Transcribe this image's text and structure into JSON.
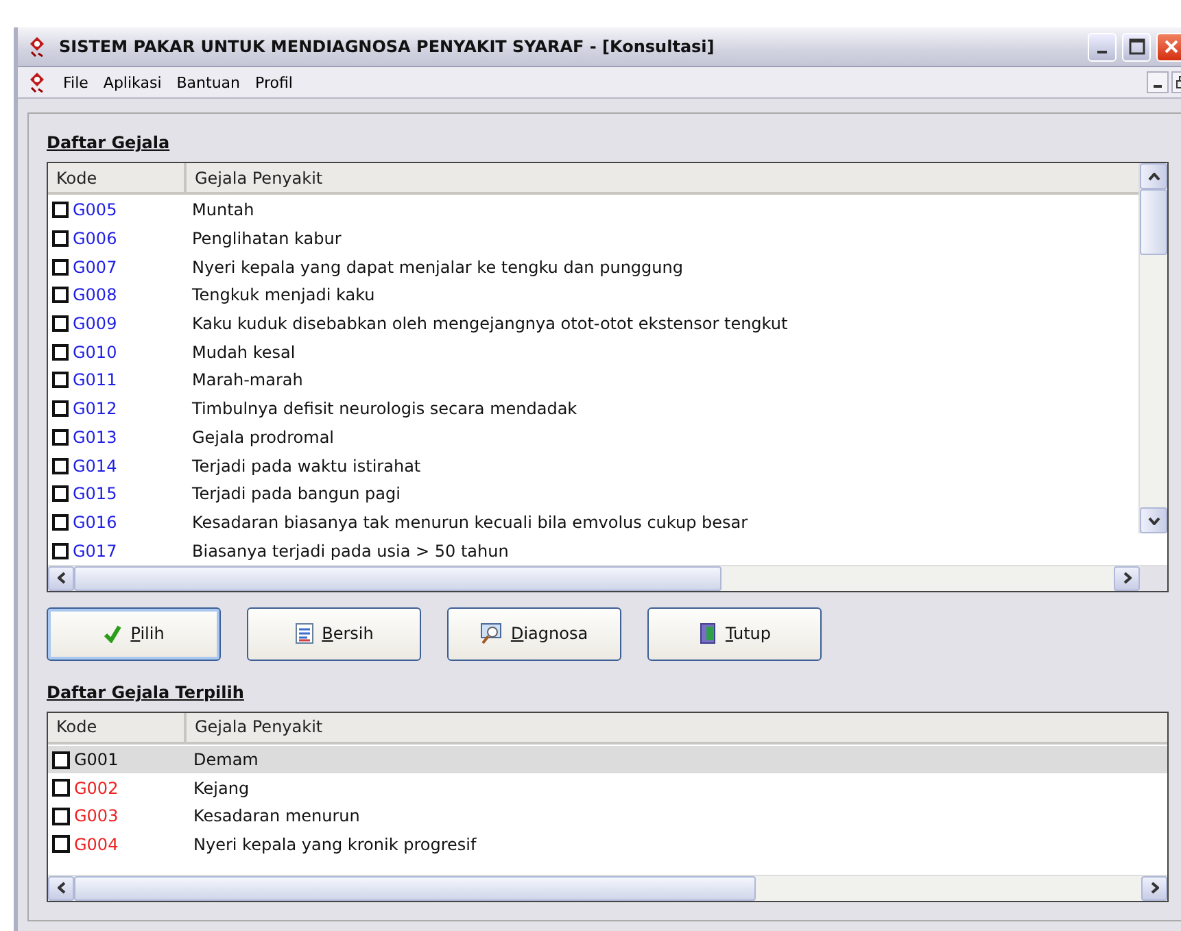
{
  "window": {
    "title": "SISTEM PAKAR UNTUK MENDIAGNOSA PENYAKIT SYARAF - [Konsultasi]"
  },
  "menu": [
    "File",
    "Aplikasi",
    "Bantuan",
    "Profil"
  ],
  "symptoms": {
    "heading": "Daftar Gejala",
    "columns": [
      "Kode",
      "Gejala Penyakit"
    ],
    "rows": [
      {
        "code": "G005",
        "name": "Muntah",
        "checked": false,
        "color": "#1e1ee6"
      },
      {
        "code": "G006",
        "name": "Penglihatan kabur",
        "checked": false,
        "color": "#1e1ee6"
      },
      {
        "code": "G007",
        "name": "Nyeri kepala yang dapat menjalar ke tengku dan punggung",
        "checked": false,
        "color": "#1e1ee6"
      },
      {
        "code": "G008",
        "name": "Tengkuk menjadi kaku",
        "checked": false,
        "color": "#1e1ee6"
      },
      {
        "code": "G009",
        "name": "Kaku kuduk disebabkan oleh mengejangnya otot-otot ekstensor tengkut",
        "checked": false,
        "color": "#1e1ee6"
      },
      {
        "code": "G010",
        "name": "Mudah kesal",
        "checked": false,
        "color": "#1e1ee6"
      },
      {
        "code": "G011",
        "name": "Marah-marah",
        "checked": false,
        "color": "#1e1ee6"
      },
      {
        "code": "G012",
        "name": "Timbulnya defisit neurologis secara mendadak",
        "checked": false,
        "color": "#1e1ee6"
      },
      {
        "code": "G013",
        "name": "Gejala prodromal",
        "checked": false,
        "color": "#1e1ee6"
      },
      {
        "code": "G014",
        "name": "Terjadi pada waktu istirahat",
        "checked": false,
        "color": "#1e1ee6"
      },
      {
        "code": "G015",
        "name": "Terjadi pada bangun pagi",
        "checked": false,
        "color": "#1e1ee6"
      },
      {
        "code": "G016",
        "name": "Kesadaran biasanya tak menurun kecuali bila emvolus cukup besar",
        "checked": false,
        "color": "#1e1ee6"
      },
      {
        "code": "G017",
        "name": "Biasanya terjadi pada usia > 50 tahun",
        "checked": false,
        "color": "#1e1ee6"
      }
    ]
  },
  "buttons": [
    {
      "label": "Pilih",
      "kind": "check"
    },
    {
      "label": "Bersih",
      "kind": "document"
    },
    {
      "label": "Diagnosa",
      "kind": "magnifier"
    },
    {
      "label": "Tutup",
      "kind": "door"
    }
  ],
  "selected_symptoms": {
    "heading": "Daftar Gejala Terpilih",
    "columns": [
      "Kode",
      "Gejala Penyakit"
    ],
    "rows": [
      {
        "code": "G001",
        "name": "Demam",
        "checked": false,
        "selected": true,
        "color": "#111111"
      },
      {
        "code": "G002",
        "name": "Kejang",
        "checked": false,
        "selected": false,
        "color": "#ee2222"
      },
      {
        "code": "G003",
        "name": "Kesadaran menurun",
        "checked": false,
        "selected": false,
        "color": "#ee2222"
      },
      {
        "code": "G004",
        "name": "Nyeri kepala yang kronik progresif",
        "checked": false,
        "selected": false,
        "color": "#ee2222"
      }
    ]
  }
}
